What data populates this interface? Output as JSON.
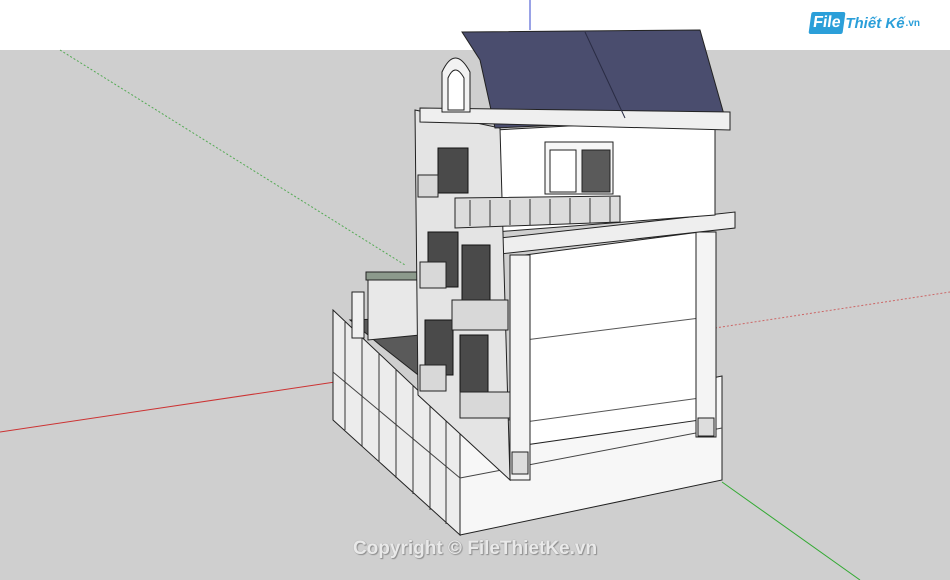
{
  "scene": {
    "sky_color": "#ffffff",
    "ground_color": "#cfcfcf",
    "roof_color": "#4a4d6e",
    "axis_colors": {
      "red": "#cc3333",
      "green": "#33aa33",
      "blue": "#3344cc"
    }
  },
  "logo": {
    "box_text": "File",
    "rest_text": "Thiết Kế",
    "tld_text": ".vn",
    "color": "#2b9fd9"
  },
  "watermark": {
    "text": "Copyright © FileThietKe.vn"
  }
}
